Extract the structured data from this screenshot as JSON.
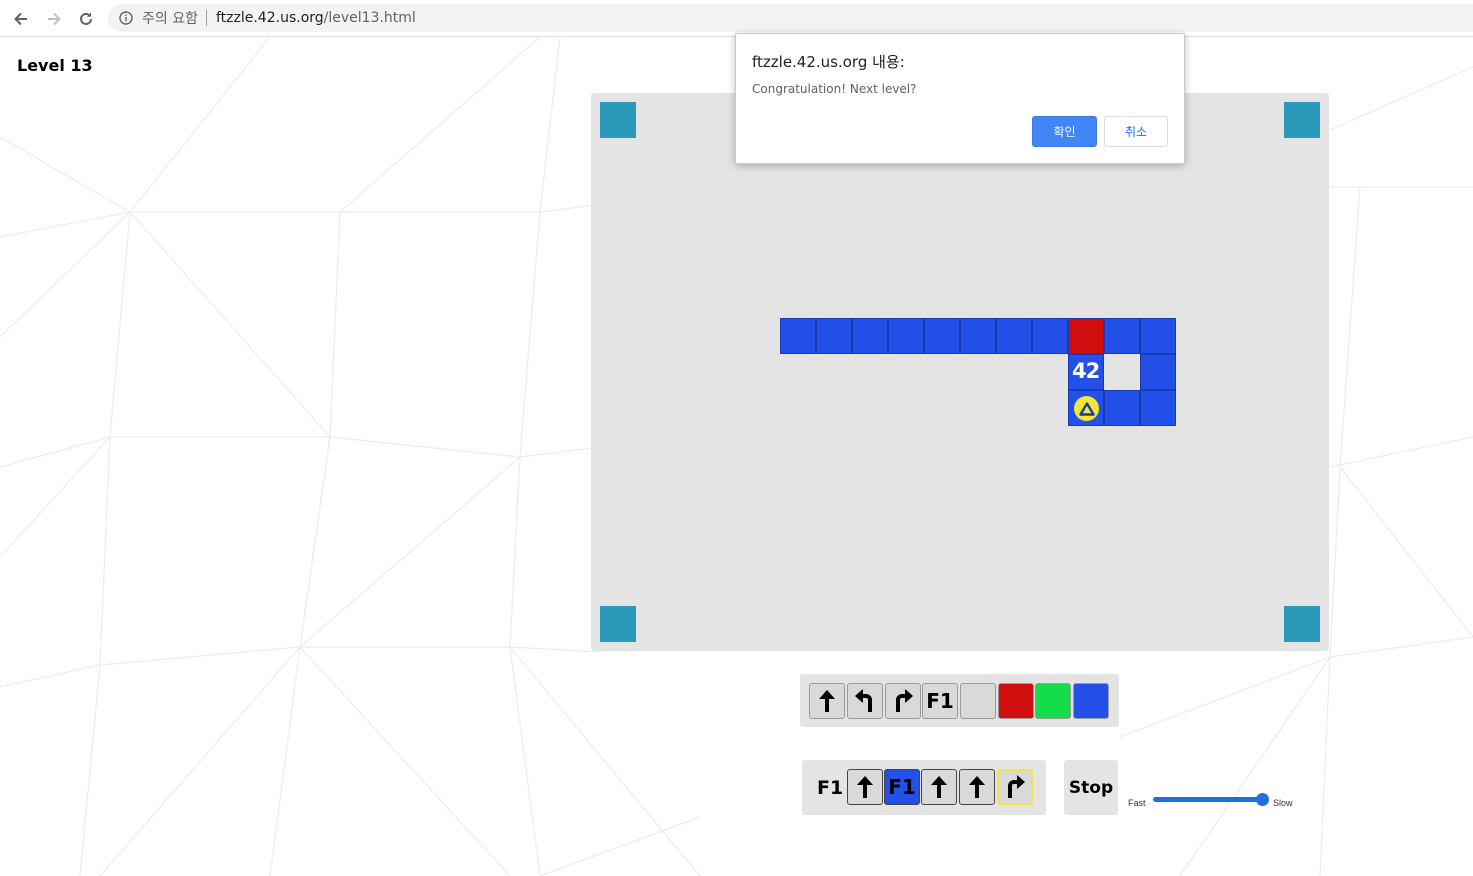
{
  "browser": {
    "security_label": "주의 요함",
    "url_host": "ftzzle.42.us.org",
    "url_path": "/level13.html"
  },
  "page": {
    "level_title": "Level 13"
  },
  "board": {
    "logo_text": "42",
    "colors": {
      "board_bg": "#e4e4e4",
      "corner": "#2b97b9",
      "blue_cell": "#2350e8",
      "red_cell": "#d10e0e",
      "player": "#f2e832"
    }
  },
  "toolbox": {
    "f1_label": "F1",
    "colors": [
      "#d9d9d9",
      "#d10e0e",
      "#14dd4a",
      "#2350e8"
    ]
  },
  "program": {
    "label": "F1",
    "slot_f1_label": "F1"
  },
  "controls": {
    "stop_label": "Stop",
    "speed_fast": "Fast",
    "speed_slow": "Slow"
  },
  "dialog": {
    "title": "ftzzle.42.us.org 내용:",
    "message": "Congratulation! Next level?",
    "ok_label": "확인",
    "cancel_label": "취소"
  }
}
